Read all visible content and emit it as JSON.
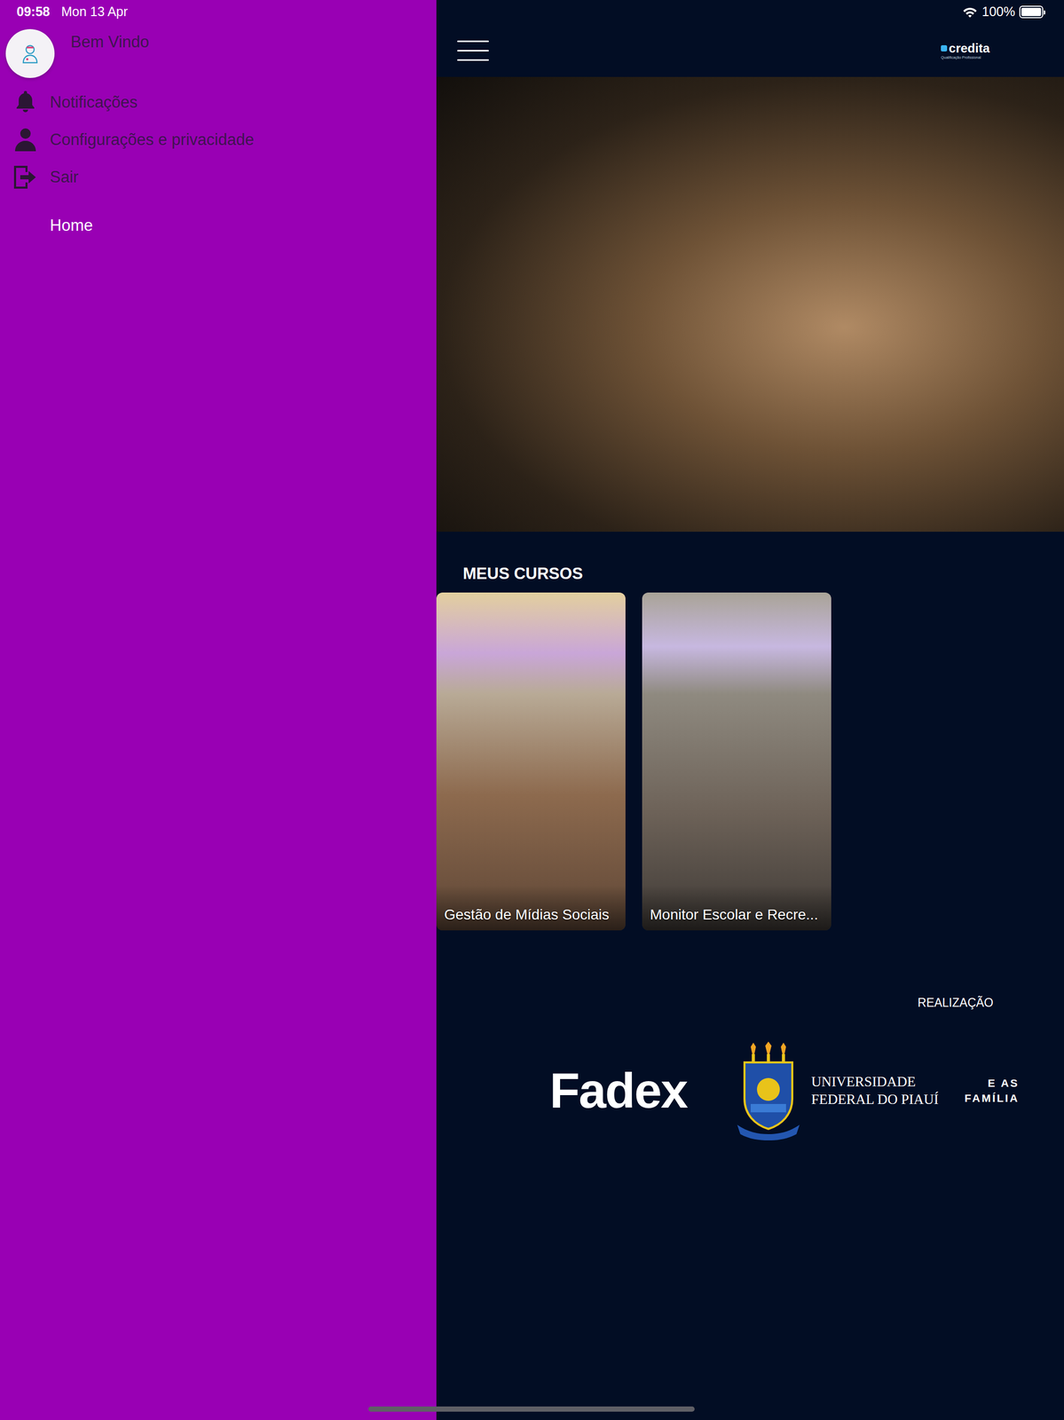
{
  "status_bar": {
    "time": "09:58",
    "date": "Mon 13 Apr",
    "battery": "100%",
    "battery_level": 1.0
  },
  "drawer": {
    "greeting": "Bem Vindo",
    "items": [
      {
        "label": "Notificações",
        "kind": "action",
        "selected": false
      },
      {
        "label": "Configurações e privacidade",
        "kind": "action",
        "selected": false
      },
      {
        "label": "Sair",
        "kind": "action",
        "selected": false
      },
      {
        "label": "Home",
        "kind": "link",
        "selected": true
      }
    ]
  },
  "header": {
    "logo": {
      "text": "credita",
      "tagline": "Qualificação Profissional"
    }
  },
  "courses": {
    "title": "MEUS CURSOS",
    "items": [
      {
        "title": "Gestão de Mídias Sociais"
      },
      {
        "title": "Monitor Escolar e Recre..."
      }
    ]
  },
  "sponsors": {
    "title": "REALIZAÇÃO",
    "items": [
      {
        "kind": "wordmark",
        "lines": [
          "Fadex"
        ]
      },
      {
        "kind": "crest",
        "lines": [
          "UNIVERSIDADE",
          "FEDERAL DO PIAUÍ"
        ]
      },
      {
        "kind": "partial",
        "lines": [
          "E AS",
          "FAMÍLIA"
        ]
      }
    ]
  }
}
